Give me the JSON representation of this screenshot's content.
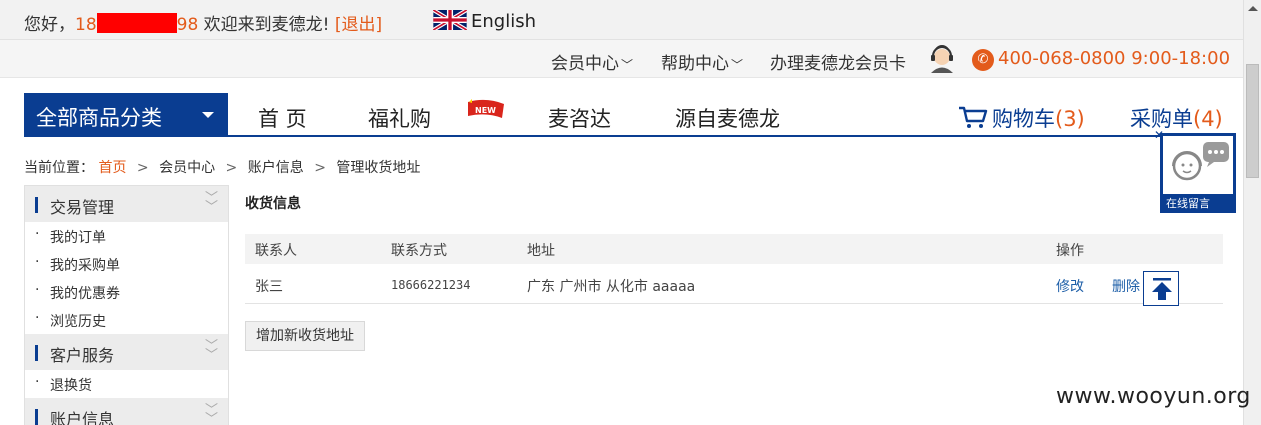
{
  "topbar": {
    "greeting": "您好，",
    "phone_prefix": "18",
    "phone_suffix": "98",
    "welcome": " 欢迎来到麦德龙!",
    "logout": "[退出]",
    "language": "English"
  },
  "subbar": {
    "member_center": "会员中心",
    "help_center": "帮助中心",
    "member_card": "办理麦德龙会员卡",
    "hotline": "400-068-0800  9:00-18:00"
  },
  "nav": {
    "all_categories": "全部商品分类",
    "items": [
      "首 页",
      "福礼购",
      "麦咨达",
      "源自麦德龙"
    ],
    "new_badge": "NEW",
    "cart_label": "购物车",
    "cart_count": "(3)",
    "purchase_label": "采购单",
    "purchase_count": "(4)"
  },
  "breadcrumb": {
    "prefix": "当前位置：",
    "items": [
      "首页",
      "会员中心",
      "账户信息",
      "管理收货地址"
    ]
  },
  "sidebar": {
    "sections": [
      {
        "title": "交易管理",
        "items": [
          "我的订单",
          "我的采购单",
          "我的优惠券",
          "浏览历史"
        ]
      },
      {
        "title": "客户服务",
        "items": [
          "退换货"
        ]
      },
      {
        "title": "账户信息",
        "items": []
      }
    ]
  },
  "content": {
    "title": "收货信息",
    "columns": [
      "联系人",
      "联系方式",
      "地址",
      "操作"
    ],
    "rows": [
      {
        "name": "张三",
        "phone": "18666221234",
        "address": "广东 广州市 从化市 aaaaa",
        "edit": "修改",
        "delete": "删除"
      }
    ],
    "add_button": "增加新收货地址"
  },
  "widget": {
    "online_message": "在线留言"
  },
  "watermark": "www.wooyun.org",
  "colors": {
    "brand_blue": "#0a3d91",
    "accent_orange": "#e35b1b",
    "link_blue": "#1e5fa8"
  },
  "icons": [
    "uk-flag-icon",
    "chevron-down-icon",
    "customer-service-icon",
    "phone-icon",
    "caret-down-icon",
    "new-flag-icon",
    "cart-icon",
    "double-chevron-icon",
    "back-to-top-icon",
    "chat-bubble-icon"
  ]
}
